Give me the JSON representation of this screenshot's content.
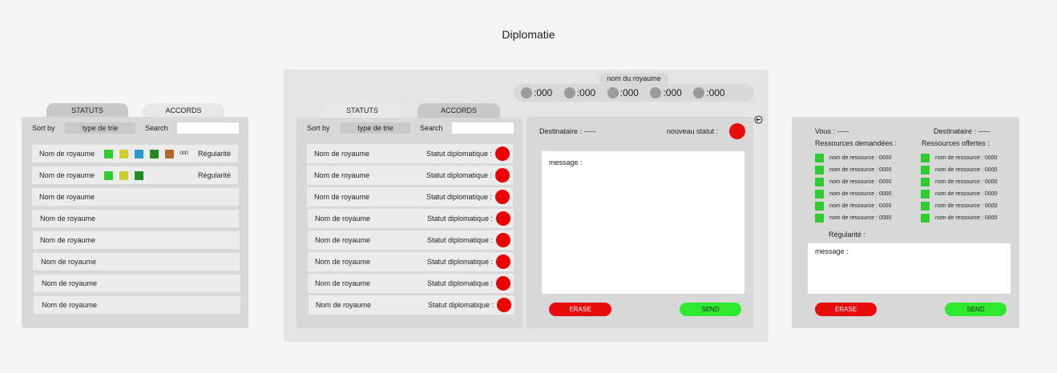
{
  "page": {
    "title": "Diplomatie"
  },
  "left_panel": {
    "tabs": {
      "statuts": "STATUTS",
      "accords": "ACCORDS"
    },
    "sort_label": "Sort by",
    "sort_value": "type de trie",
    "search_label": "Search",
    "rows": [
      {
        "name": "Nom de royaume",
        "rule": "Régularité",
        "more": "ooo"
      },
      {
        "name": "Nom de royaume",
        "rule": "Régularité"
      },
      {
        "name": "Nom de royaume"
      },
      {
        "name": "Nom de royaume"
      },
      {
        "name": "Nom de royaume"
      },
      {
        "name": "Nom de royaume"
      },
      {
        "name": "Nom de royaume"
      },
      {
        "name": "Nom de royaume"
      }
    ]
  },
  "center_panel": {
    "kingdom_label": "nom du royaume",
    "resources": [
      ":000",
      ":000",
      ":000",
      ":000",
      ":000"
    ],
    "tabs": {
      "statuts": "STATUTS",
      "accords": "ACCORDS"
    },
    "sort_label": "Sort by",
    "sort_value": "type de trie",
    "search_label": "Search",
    "rows": [
      {
        "name": "Nom de royaume",
        "status": "Statut diplomatique :"
      },
      {
        "name": "Nom de royaume",
        "status": "Statut diplomatique :"
      },
      {
        "name": "Nom de royaume",
        "status": "Statut diplomatique :"
      },
      {
        "name": "Nom de royaume",
        "status": "Statut diplomatique :"
      },
      {
        "name": "Nom de royaume",
        "status": "Statut diplomatique :"
      },
      {
        "name": "Nom de royaume",
        "status": "Statut diplomatique :"
      },
      {
        "name": "Nom de royaume",
        "status": "Statut diplomatique :"
      },
      {
        "name": "Nom de royaume",
        "status": "Statut diplomatique :"
      }
    ],
    "message_box": {
      "recipient": "Destinataire : -----",
      "new_status": "nouveau statut :",
      "message_placeholder": "message :",
      "erase": "ERASE",
      "send": "SEND"
    }
  },
  "right_panel": {
    "you": "Vous : -----",
    "recipient": "Destinataire : -----",
    "requested_title": "Ressources demandées :",
    "offered_title": "Ressources offertes :",
    "requested": [
      "nom de ressource : 0000",
      "nom de ressource : 0000",
      "nom de ressource : 0000",
      "nom de ressource : 0000",
      "nom de ressource : 0000",
      "nom de ressource : 0000"
    ],
    "offered": [
      "nom de ressource : 0000",
      "nom de ressource : 0000",
      "nom de ressource : 0000",
      "nom de ressource : 0000",
      "nom de ressource : 0000",
      "nom de ressource : 0000"
    ],
    "regularity": "Régularité :",
    "message_placeholder": "message :",
    "erase": "ERASE",
    "send": "SEND"
  },
  "colors": {
    "accord_1": "#2ecc2e",
    "accord_2": "#cccc33",
    "accord_3": "#2a98d2",
    "accord_4": "#228b22",
    "accord_5": "#b3662a",
    "status_red": "#e80d0d",
    "send_green": "#2ee82e"
  }
}
